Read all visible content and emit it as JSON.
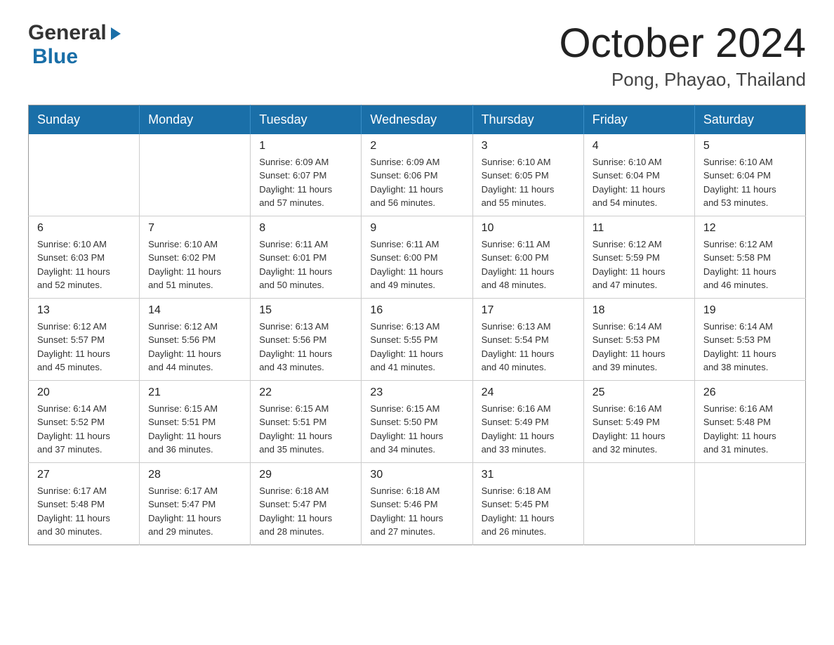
{
  "header": {
    "logo": {
      "general": "General",
      "arrow": "▶",
      "blue": "Blue"
    },
    "title": "October 2024",
    "location": "Pong, Phayao, Thailand"
  },
  "weekdays": [
    "Sunday",
    "Monday",
    "Tuesday",
    "Wednesday",
    "Thursday",
    "Friday",
    "Saturday"
  ],
  "weeks": [
    [
      {
        "day": "",
        "info": ""
      },
      {
        "day": "",
        "info": ""
      },
      {
        "day": "1",
        "info": "Sunrise: 6:09 AM\nSunset: 6:07 PM\nDaylight: 11 hours\nand 57 minutes."
      },
      {
        "day": "2",
        "info": "Sunrise: 6:09 AM\nSunset: 6:06 PM\nDaylight: 11 hours\nand 56 minutes."
      },
      {
        "day": "3",
        "info": "Sunrise: 6:10 AM\nSunset: 6:05 PM\nDaylight: 11 hours\nand 55 minutes."
      },
      {
        "day": "4",
        "info": "Sunrise: 6:10 AM\nSunset: 6:04 PM\nDaylight: 11 hours\nand 54 minutes."
      },
      {
        "day": "5",
        "info": "Sunrise: 6:10 AM\nSunset: 6:04 PM\nDaylight: 11 hours\nand 53 minutes."
      }
    ],
    [
      {
        "day": "6",
        "info": "Sunrise: 6:10 AM\nSunset: 6:03 PM\nDaylight: 11 hours\nand 52 minutes."
      },
      {
        "day": "7",
        "info": "Sunrise: 6:10 AM\nSunset: 6:02 PM\nDaylight: 11 hours\nand 51 minutes."
      },
      {
        "day": "8",
        "info": "Sunrise: 6:11 AM\nSunset: 6:01 PM\nDaylight: 11 hours\nand 50 minutes."
      },
      {
        "day": "9",
        "info": "Sunrise: 6:11 AM\nSunset: 6:00 PM\nDaylight: 11 hours\nand 49 minutes."
      },
      {
        "day": "10",
        "info": "Sunrise: 6:11 AM\nSunset: 6:00 PM\nDaylight: 11 hours\nand 48 minutes."
      },
      {
        "day": "11",
        "info": "Sunrise: 6:12 AM\nSunset: 5:59 PM\nDaylight: 11 hours\nand 47 minutes."
      },
      {
        "day": "12",
        "info": "Sunrise: 6:12 AM\nSunset: 5:58 PM\nDaylight: 11 hours\nand 46 minutes."
      }
    ],
    [
      {
        "day": "13",
        "info": "Sunrise: 6:12 AM\nSunset: 5:57 PM\nDaylight: 11 hours\nand 45 minutes."
      },
      {
        "day": "14",
        "info": "Sunrise: 6:12 AM\nSunset: 5:56 PM\nDaylight: 11 hours\nand 44 minutes."
      },
      {
        "day": "15",
        "info": "Sunrise: 6:13 AM\nSunset: 5:56 PM\nDaylight: 11 hours\nand 43 minutes."
      },
      {
        "day": "16",
        "info": "Sunrise: 6:13 AM\nSunset: 5:55 PM\nDaylight: 11 hours\nand 41 minutes."
      },
      {
        "day": "17",
        "info": "Sunrise: 6:13 AM\nSunset: 5:54 PM\nDaylight: 11 hours\nand 40 minutes."
      },
      {
        "day": "18",
        "info": "Sunrise: 6:14 AM\nSunset: 5:53 PM\nDaylight: 11 hours\nand 39 minutes."
      },
      {
        "day": "19",
        "info": "Sunrise: 6:14 AM\nSunset: 5:53 PM\nDaylight: 11 hours\nand 38 minutes."
      }
    ],
    [
      {
        "day": "20",
        "info": "Sunrise: 6:14 AM\nSunset: 5:52 PM\nDaylight: 11 hours\nand 37 minutes."
      },
      {
        "day": "21",
        "info": "Sunrise: 6:15 AM\nSunset: 5:51 PM\nDaylight: 11 hours\nand 36 minutes."
      },
      {
        "day": "22",
        "info": "Sunrise: 6:15 AM\nSunset: 5:51 PM\nDaylight: 11 hours\nand 35 minutes."
      },
      {
        "day": "23",
        "info": "Sunrise: 6:15 AM\nSunset: 5:50 PM\nDaylight: 11 hours\nand 34 minutes."
      },
      {
        "day": "24",
        "info": "Sunrise: 6:16 AM\nSunset: 5:49 PM\nDaylight: 11 hours\nand 33 minutes."
      },
      {
        "day": "25",
        "info": "Sunrise: 6:16 AM\nSunset: 5:49 PM\nDaylight: 11 hours\nand 32 minutes."
      },
      {
        "day": "26",
        "info": "Sunrise: 6:16 AM\nSunset: 5:48 PM\nDaylight: 11 hours\nand 31 minutes."
      }
    ],
    [
      {
        "day": "27",
        "info": "Sunrise: 6:17 AM\nSunset: 5:48 PM\nDaylight: 11 hours\nand 30 minutes."
      },
      {
        "day": "28",
        "info": "Sunrise: 6:17 AM\nSunset: 5:47 PM\nDaylight: 11 hours\nand 29 minutes."
      },
      {
        "day": "29",
        "info": "Sunrise: 6:18 AM\nSunset: 5:47 PM\nDaylight: 11 hours\nand 28 minutes."
      },
      {
        "day": "30",
        "info": "Sunrise: 6:18 AM\nSunset: 5:46 PM\nDaylight: 11 hours\nand 27 minutes."
      },
      {
        "day": "31",
        "info": "Sunrise: 6:18 AM\nSunset: 5:45 PM\nDaylight: 11 hours\nand 26 minutes."
      },
      {
        "day": "",
        "info": ""
      },
      {
        "day": "",
        "info": ""
      }
    ]
  ]
}
